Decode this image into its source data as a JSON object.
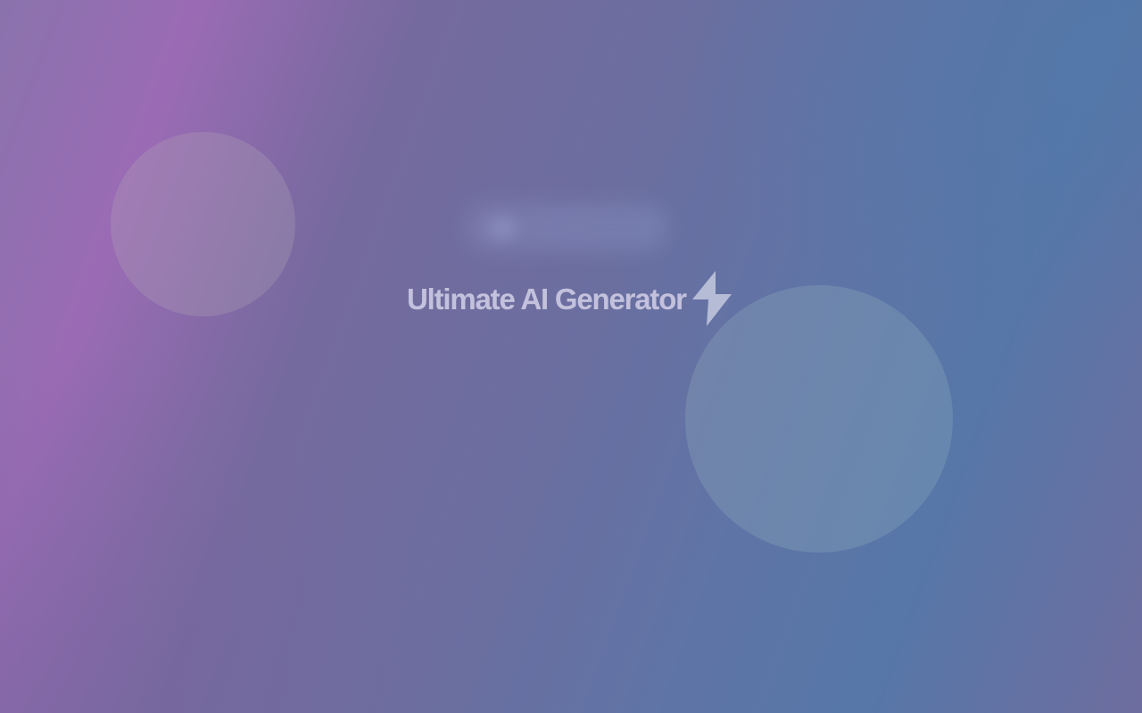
{
  "hero": {
    "title": "Ultimate AI Generator",
    "icon": "lightning-bolt-icon"
  },
  "colors": {
    "gradient_start": "#9a6bb4",
    "gradient_mid": "#6c6e9f",
    "gradient_end": "#5677a8",
    "title_text": "#c3c1dc",
    "bolt": "#c4c9df"
  }
}
